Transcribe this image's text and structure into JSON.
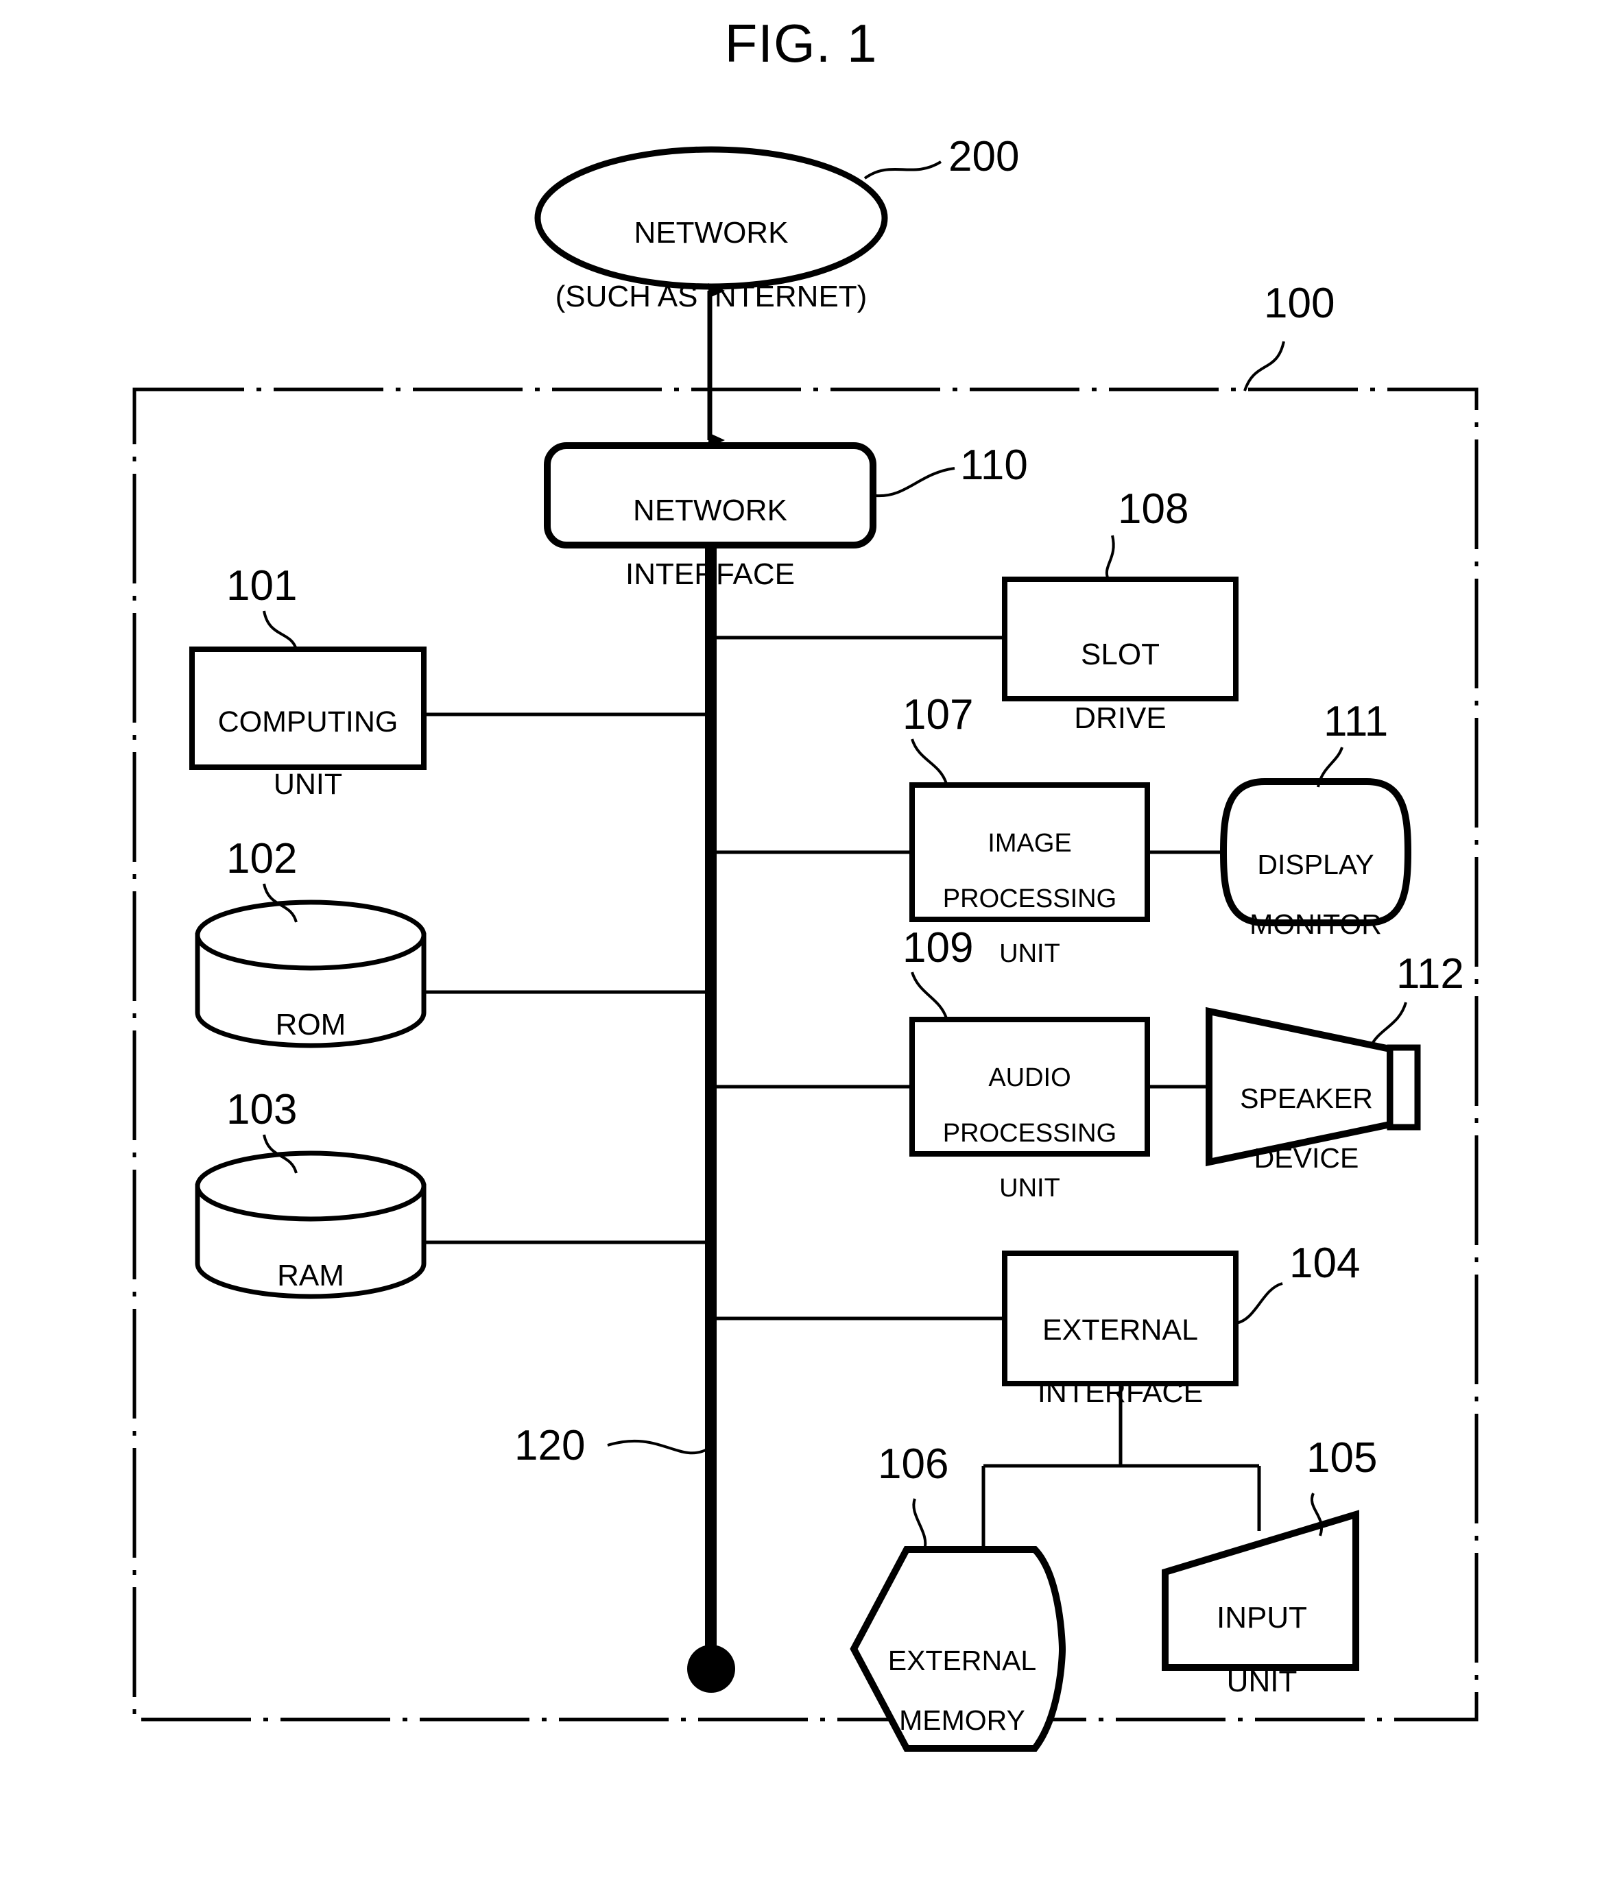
{
  "figure": {
    "title": "FIG. 1",
    "type": "block-diagram",
    "description": "Information processing apparatus hardware block diagram"
  },
  "outer_boundary": {
    "reference": "100",
    "line_style": "dash-dot"
  },
  "network": {
    "label": "NETWORK\n(SUCH AS INTERNET)",
    "line1": "NETWORK",
    "line2": "(SUCH AS INTERNET)",
    "reference": "200",
    "shape": "ellipse"
  },
  "bus": {
    "reference": "120",
    "shape": "thick-vertical-line-with-terminal-dot"
  },
  "blocks": [
    {
      "id": "network-interface",
      "label": "NETWORK\nINTERFACE",
      "line1": "NETWORK",
      "line2": "INTERFACE",
      "reference": "110",
      "shape": "rounded-rect"
    },
    {
      "id": "computing-unit",
      "label": "COMPUTING\nUNIT",
      "line1": "COMPUTING",
      "line2": "UNIT",
      "reference": "101",
      "shape": "rect"
    },
    {
      "id": "rom",
      "label": "ROM",
      "line1": "ROM",
      "line2": "",
      "reference": "102",
      "shape": "cylinder"
    },
    {
      "id": "ram",
      "label": "RAM",
      "line1": "RAM",
      "line2": "",
      "reference": "103",
      "shape": "cylinder"
    },
    {
      "id": "slot-drive",
      "label": "SLOT\nDRIVE",
      "line1": "SLOT",
      "line2": "DRIVE",
      "reference": "108",
      "shape": "rect"
    },
    {
      "id": "image-processing-unit",
      "label": "IMAGE\nPROCESSING\nUNIT",
      "line1": "IMAGE",
      "line2": "PROCESSING",
      "line3": "UNIT",
      "reference": "107",
      "shape": "rect"
    },
    {
      "id": "display-monitor",
      "label": "DISPLAY\nMONITOR",
      "line1": "DISPLAY",
      "line2": "MONITOR",
      "reference": "111",
      "shape": "crt-rounded"
    },
    {
      "id": "audio-processing-unit",
      "label": "AUDIO\nPROCESSING\nUNIT",
      "line1": "AUDIO",
      "line2": "PROCESSING",
      "line3": "UNIT",
      "reference": "109",
      "shape": "rect"
    },
    {
      "id": "speaker-device",
      "label": "SPEAKER\nDEVICE",
      "line1": "SPEAKER",
      "line2": "DEVICE",
      "reference": "112",
      "shape": "speaker-trapezoid"
    },
    {
      "id": "external-interface",
      "label": "EXTERNAL\nINTERFACE",
      "line1": "EXTERNAL",
      "line2": "INTERFACE",
      "reference": "104",
      "shape": "rect"
    },
    {
      "id": "external-memory",
      "label": "EXTERNAL\nMEMORY",
      "line1": "EXTERNAL",
      "line2": "MEMORY",
      "reference": "106",
      "shape": "hexagon-drum"
    },
    {
      "id": "input-unit",
      "label": "INPUT\nUNIT",
      "line1": "INPUT",
      "line2": "UNIT",
      "reference": "105",
      "shape": "slanted-quad"
    }
  ],
  "colors": {
    "stroke": "#000000",
    "background": "#ffffff"
  }
}
